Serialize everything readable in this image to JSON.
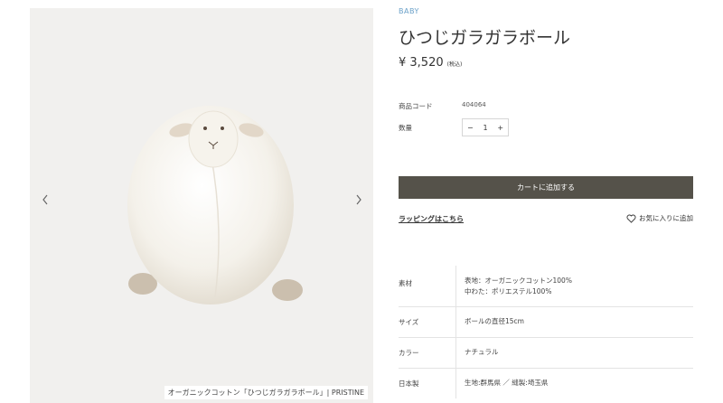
{
  "gallery": {
    "caption": "オーガニックコットン「ひつじガラガラボール」| PRISTINE",
    "prev_icon": "chevron-left-icon",
    "next_icon": "chevron-right-icon"
  },
  "product": {
    "category": "BABY",
    "title": "ひつじガラガラボール",
    "price": "¥ 3,520",
    "tax_note": "(税込)",
    "code_label": "商品コード",
    "code_value": "404064",
    "qty_label": "数量",
    "qty_minus": "−",
    "qty_value": "1",
    "qty_plus": "+",
    "cart_button": "カートに追加する",
    "wrapping_link": "ラッピングはこちら",
    "favorite_label": "お気に入りに追加",
    "favorite_icon": "heart-outline-icon"
  },
  "specs": [
    {
      "label": "素材",
      "lines": [
        "表地：オーガニックコットン100%",
        "中わた：ポリエステル100%"
      ]
    },
    {
      "label": "サイズ",
      "lines": [
        "ボールの直径15cm"
      ]
    },
    {
      "label": "カラー",
      "lines": [
        "ナチュラル"
      ]
    },
    {
      "label": "日本製",
      "lines": [
        "生地:群馬県 ／ 縫製:埼玉県"
      ]
    }
  ]
}
